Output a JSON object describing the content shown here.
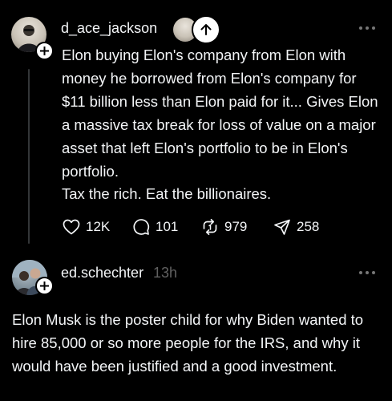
{
  "colors": {
    "background": "#000000",
    "primary_text": "#f3f5f7",
    "secondary_text": "#616161",
    "thread_line": "#333638"
  },
  "post1": {
    "username": "d_ace_jackson",
    "body": "Elon buying Elon's company from Elon with money he borrowed from Elon's company for $11 billion less than Elon paid for it... Gives Elon a massive tax break for loss of value on a major asset that left Elon's portfolio to be in Elon's portfolio.",
    "body2": "Tax the rich. Eat the billionaires.",
    "likes": "12K",
    "replies": "101",
    "reposts": "979",
    "shares": "258"
  },
  "post2": {
    "username": "ed.schechter",
    "timestamp": "13h",
    "body": "Elon Musk is the poster child for why Biden wanted to hire 85,000 or so more people for the IRS, and why it would have been justified and a good investment."
  }
}
